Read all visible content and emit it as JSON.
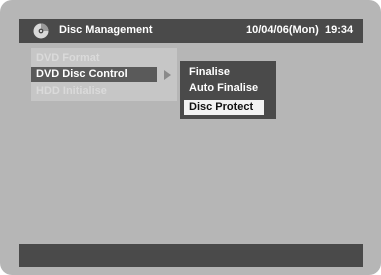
{
  "header": {
    "icon": "disc-icon",
    "title": "Disc Management",
    "date": "10/04/06(Mon)",
    "time": "19:34"
  },
  "main_menu": {
    "items": [
      {
        "label": "DVD Format",
        "state": "disabled"
      },
      {
        "label": "DVD Disc Control",
        "state": "selected"
      },
      {
        "label": "HDD Initialise",
        "state": "disabled"
      }
    ],
    "submenu_indicator_icon": "triangle-right-icon"
  },
  "sub_menu": {
    "items": [
      {
        "label": "Finalise",
        "state": "normal"
      },
      {
        "label": "Auto Finalise",
        "state": "normal"
      },
      {
        "label": "Disc Protect",
        "state": "highlighted"
      }
    ]
  },
  "footer": {
    "text": ""
  },
  "colors": {
    "background": "#b6b6b6",
    "bar": "#4a4a4a",
    "menu_panel": "#c6c6c6",
    "selected": "#5a5a5a",
    "highlight": "#f2f2f2",
    "disabled_text": "#dadada"
  }
}
